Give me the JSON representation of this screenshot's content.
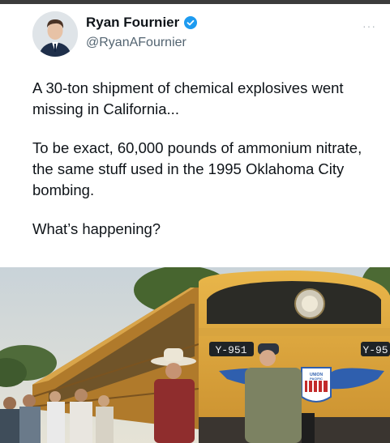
{
  "author": {
    "name": "Ryan Fournier",
    "handle": "@RyanAFournier",
    "verified": true,
    "more_icon": "more-options-icon"
  },
  "tweet": {
    "paragraphs": [
      "A 30-ton shipment of chemical explosives went missing in California...",
      "To be exact, 60,000 pounds of ammonium nitrate, the same stuff used in the 1995 Oklahoma City bombing.",
      "What’s happening?"
    ]
  },
  "media": {
    "locomotive_number_left": "Y-951",
    "locomotive_number_right": "Y-95",
    "logo_text_top": "UNION",
    "logo_text_bottom": "PACIFIC"
  },
  "colors": {
    "verified": "#1d9bf0",
    "locomotive": "#e0a93c",
    "wings": "#2f5fae"
  }
}
